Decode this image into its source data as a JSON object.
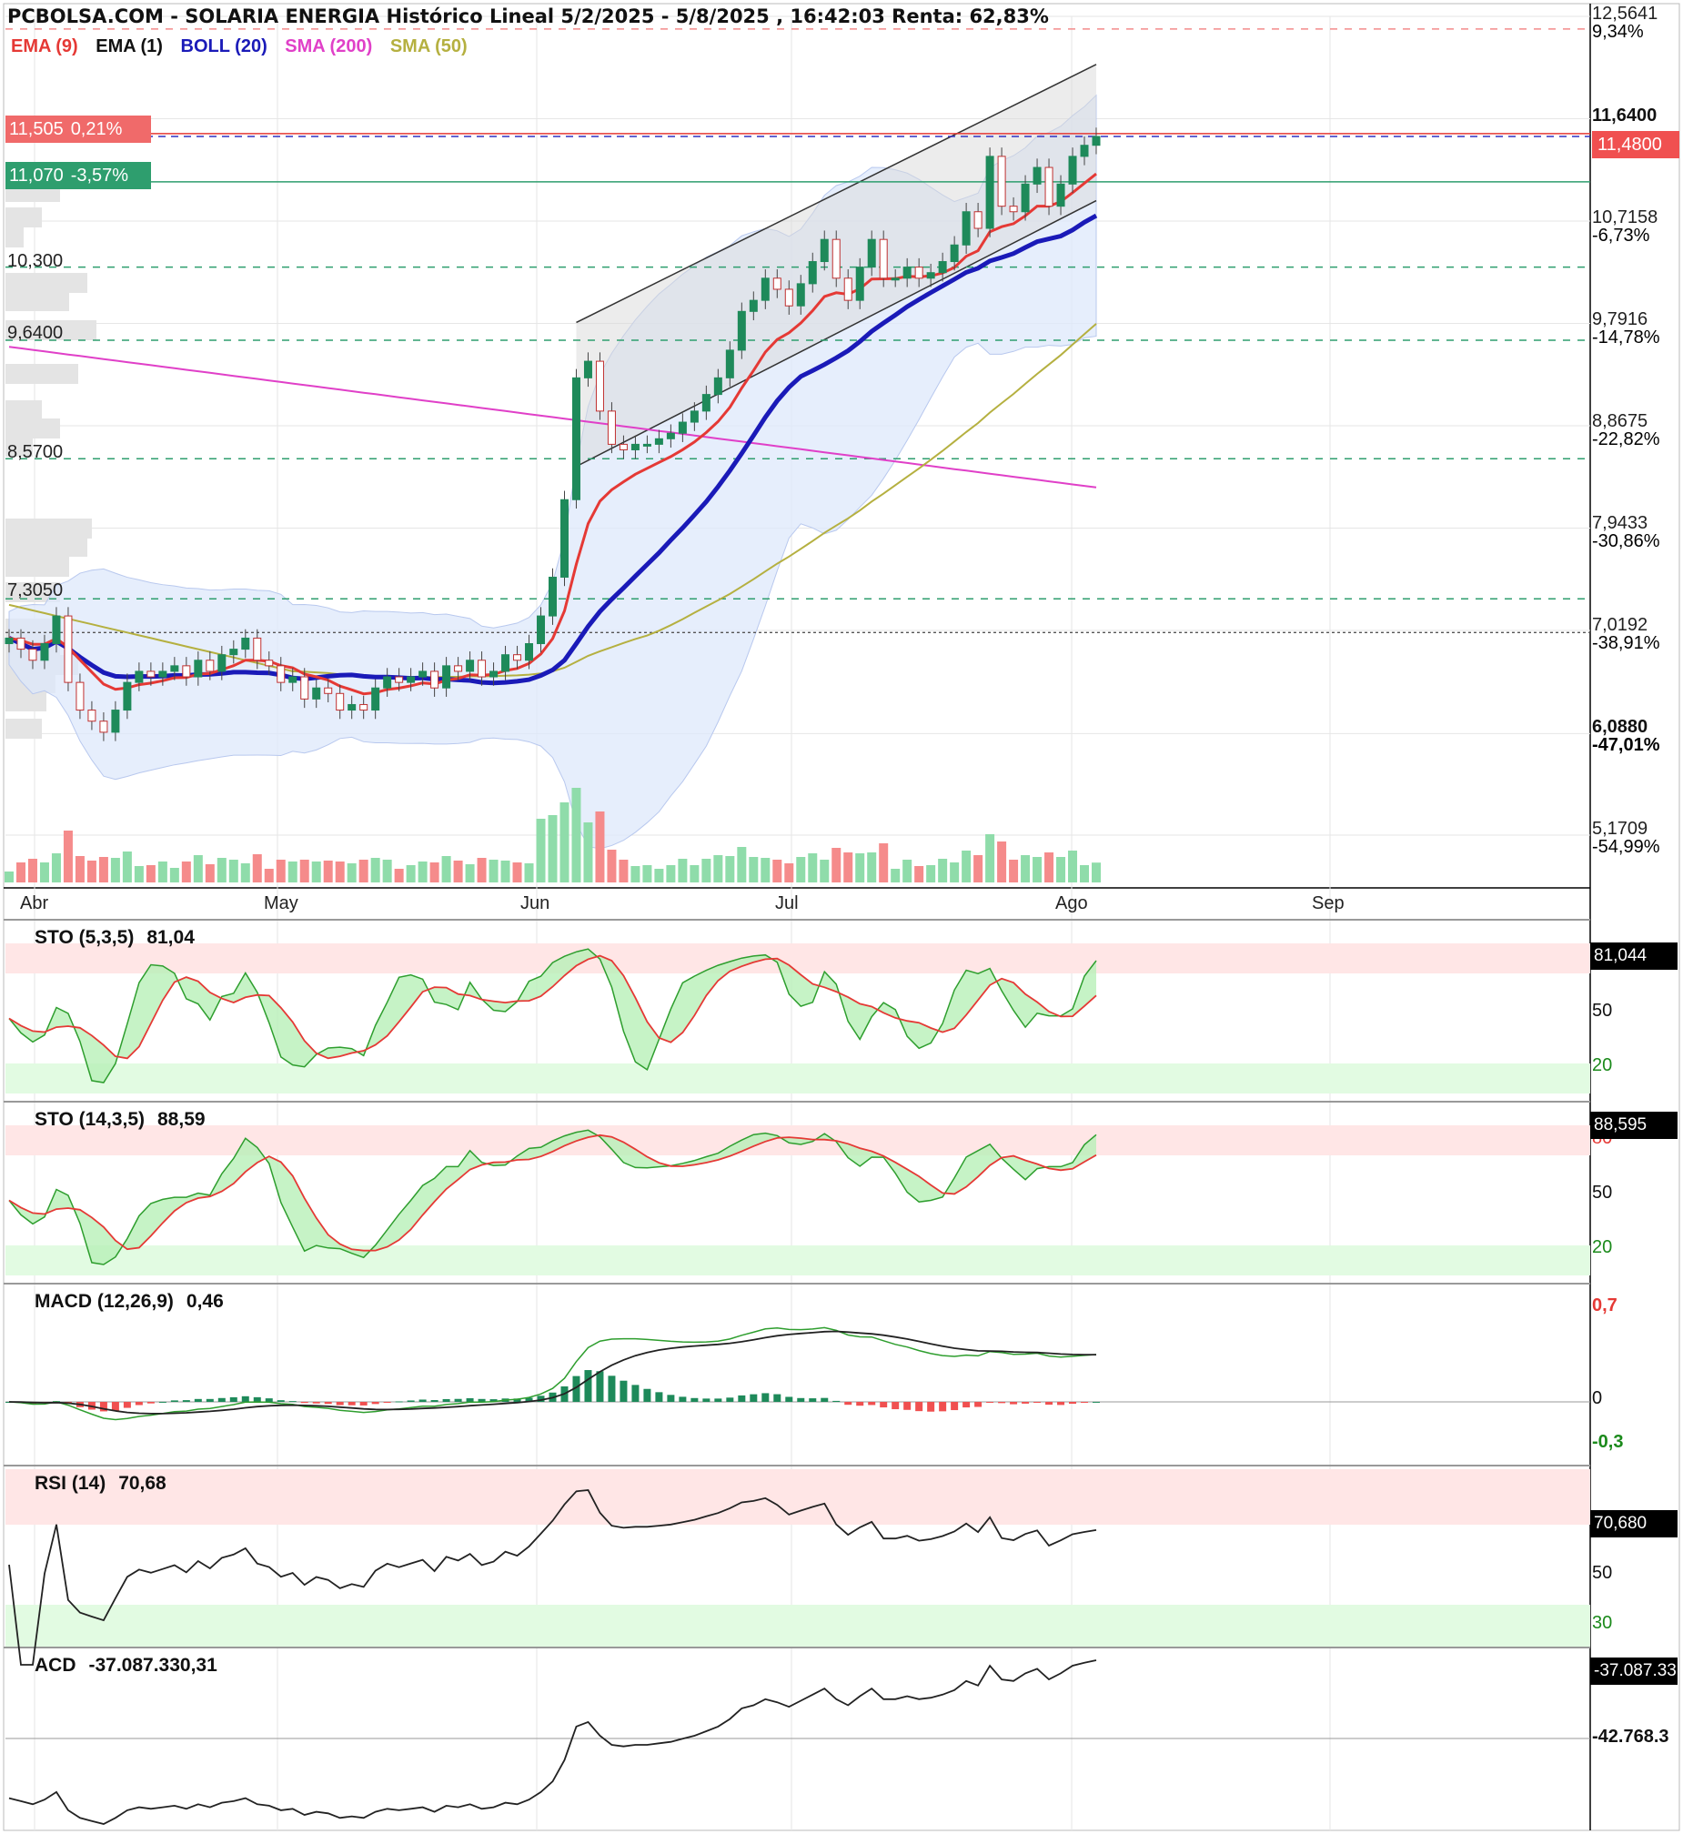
{
  "header": {
    "title": "PCBOLSA.COM - SOLARIA ENERGIA Histórico Lineal 5/2/2025 - 5/8/2025 , 16:42:03 Renta: 62,83%"
  },
  "legend": {
    "items": [
      {
        "label": "EMA (9)",
        "color": "#e53935"
      },
      {
        "label": "EMA (1)",
        "color": "#111111"
      },
      {
        "label": "BOLL (20)",
        "color": "#1a1ab8"
      },
      {
        "label": "SMA (200)",
        "color": "#e040c8"
      },
      {
        "label": "SMA (50)",
        "color": "#b5b040"
      }
    ]
  },
  "tags": {
    "upper": {
      "price": "11,505",
      "pct": "0,21%",
      "color": "#f06a6a"
    },
    "lower": {
      "price": "11,070",
      "pct": "-3,57%",
      "color": "#2e9e6e"
    }
  },
  "left_levels": [
    "10,300",
    "9,6400",
    "8,5700",
    "7,3050"
  ],
  "right_axis": {
    "ticks": [
      {
        "price": "12,5641",
        "pct": "9,34%",
        "pct_color": "#2e9e6e"
      },
      {
        "price": "11,6400",
        "pct": "",
        "pct_color": "#222"
      },
      {
        "price": "10,7158",
        "pct": "-6,73%",
        "pct_color": "#e53935"
      },
      {
        "price": "9,7916",
        "pct": "-14,78%",
        "pct_color": "#e53935"
      },
      {
        "price": "8,8675",
        "pct": "-22,82%",
        "pct_color": "#e53935"
      },
      {
        "price": "7,9433",
        "pct": "-30,86%",
        "pct_color": "#e53935"
      },
      {
        "price": "7,0192",
        "pct": "-38,91%",
        "pct_color": "#e53935"
      },
      {
        "price": "6,0880",
        "pct": "-47,01%",
        "pct_color": "#e53935"
      },
      {
        "price": "5,1709",
        "pct": "-54,99%",
        "pct_color": "#e53935"
      }
    ],
    "last_price": "11,4800"
  },
  "months": [
    "Abr",
    "May",
    "Jun",
    "Jul",
    "Ago",
    "Sep"
  ],
  "panels": {
    "sto1": {
      "label": "STO (5,3,5)",
      "value": "81,04",
      "badge": "81,044",
      "levels": [
        "50",
        "20"
      ]
    },
    "sto2": {
      "label": "STO (14,3,5)",
      "value": "88,59",
      "badge": "88,595",
      "levels": [
        "80",
        "50",
        "20"
      ]
    },
    "macd": {
      "label": "MACD (12,26,9)",
      "value": "0,46",
      "levels": [
        "0,7",
        "0",
        "-0,3"
      ]
    },
    "rsi": {
      "label": "RSI (14)",
      "value": "70,68",
      "badge": "70,680",
      "levels": [
        "50",
        "30"
      ]
    },
    "acd": {
      "label": "ACD",
      "value": "-37.087.330,31",
      "badge": "-37.087.33",
      "levels": [
        "-42.768.3"
      ]
    }
  },
  "chart_data": {
    "type": "candlestick",
    "x_range": [
      "2025-04-01",
      "2025-09-30"
    ],
    "ylim": [
      5.1709,
      12.5641
    ],
    "close_series": [
      6.95,
      6.85,
      6.75,
      6.9,
      7.15,
      6.55,
      6.3,
      6.2,
      6.1,
      6.3,
      6.55,
      6.65,
      6.6,
      6.65,
      6.7,
      6.6,
      6.75,
      6.65,
      6.8,
      6.85,
      6.95,
      6.75,
      6.7,
      6.55,
      6.6,
      6.4,
      6.5,
      6.45,
      6.3,
      6.35,
      6.3,
      6.5,
      6.6,
      6.55,
      6.6,
      6.65,
      6.5,
      6.7,
      6.65,
      6.75,
      6.6,
      6.65,
      6.8,
      6.75,
      6.9,
      7.15,
      7.5,
      8.2,
      9.3,
      9.45,
      9.0,
      8.7,
      8.65,
      8.7,
      8.7,
      8.75,
      8.8,
      8.9,
      9.0,
      9.15,
      9.3,
      9.55,
      9.9,
      10.0,
      10.2,
      10.1,
      9.95,
      10.15,
      10.35,
      10.55,
      10.2,
      10.0,
      10.3,
      10.55,
      10.2,
      10.2,
      10.3,
      10.2,
      10.25,
      10.35,
      10.5,
      10.8,
      10.65,
      11.3,
      10.85,
      10.8,
      11.05,
      11.2,
      10.85,
      11.05,
      11.3,
      11.4,
      11.48
    ]
  }
}
